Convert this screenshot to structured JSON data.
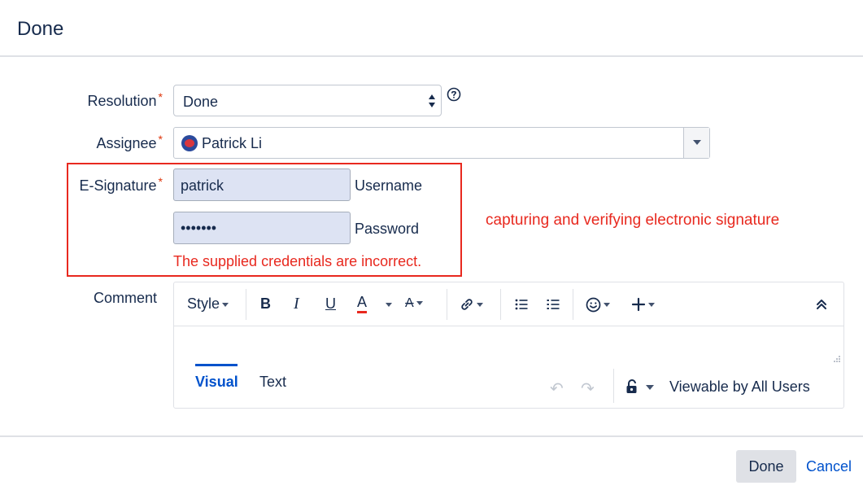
{
  "dialog": {
    "title": "Done"
  },
  "form": {
    "resolution": {
      "label": "Resolution",
      "value": "Done"
    },
    "assignee": {
      "label": "Assignee",
      "value": "Patrick Li"
    },
    "esignature": {
      "label": "E-Signature",
      "username_value": "patrick",
      "username_suffix": "Username",
      "password_mask": "•••••••",
      "password_suffix": "Password",
      "error": "The supplied credentials are incorrect."
    },
    "comment": {
      "label": "Comment"
    },
    "required_mark": "*"
  },
  "annotation": "capturing and verifying electronic signature",
  "editor": {
    "toolbar": {
      "style_label": "Style",
      "bold": "B",
      "italic": "I",
      "underline": "U",
      "text_color": "A",
      "more_format": "A"
    },
    "tabs": {
      "visual": "Visual",
      "text": "Text"
    },
    "visibility": "Viewable by All Users",
    "undo": "↶",
    "redo": "↷"
  },
  "footer": {
    "done_label": "Done",
    "cancel_label": "Cancel"
  },
  "colors": {
    "error": "#e8291f",
    "link": "#0052cc",
    "input_fill": "#dde3f3"
  }
}
